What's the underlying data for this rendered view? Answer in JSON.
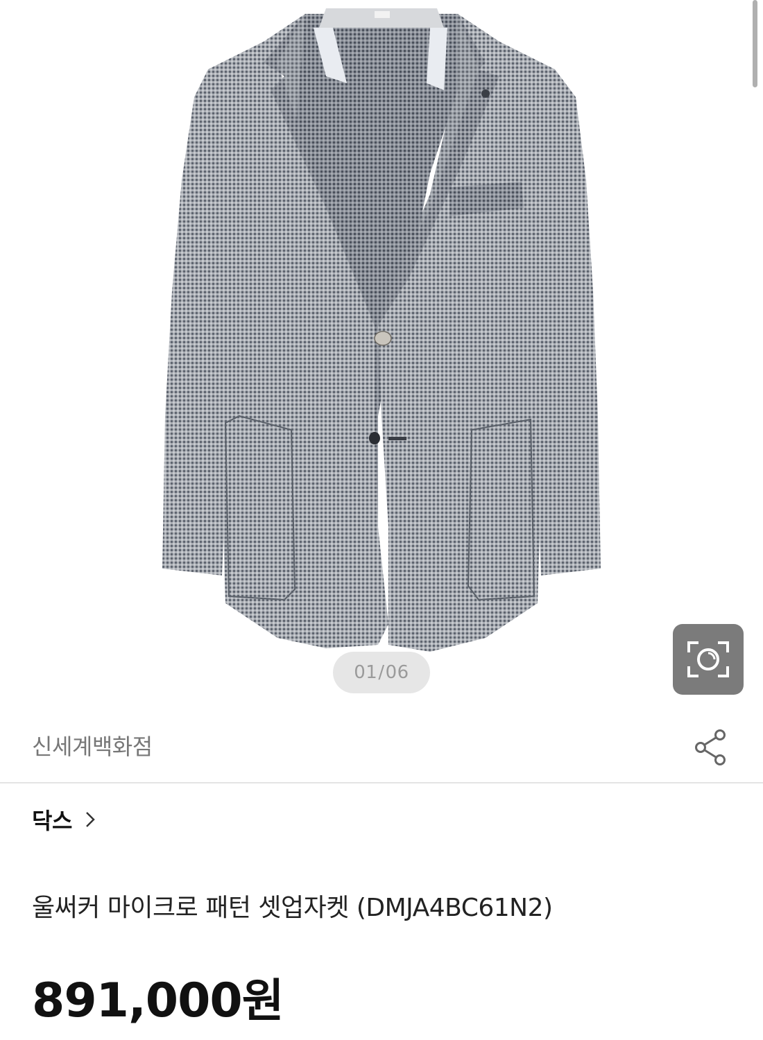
{
  "gallery": {
    "image_alt": "울써커 마이크로 패턴 셋업자켓",
    "current_index": "01",
    "total": "06",
    "separator": "/"
  },
  "icons": {
    "lens": "camera-lens-search-icon",
    "share": "share-icon",
    "chevron": "chevron-right-icon"
  },
  "seller": {
    "name": "신세계백화점"
  },
  "brand": {
    "name": "닥스"
  },
  "product": {
    "title": "울써커 마이크로 패턴 셋업자켓 (DMJA4BC61N2)",
    "price_amount": "891,000",
    "price_unit": "원"
  },
  "colors": {
    "lens_button_bg": "#7b7b7b",
    "indicator_bg": "#e6e6e6",
    "divider": "#e4e4e4",
    "seller_text": "#777777"
  }
}
